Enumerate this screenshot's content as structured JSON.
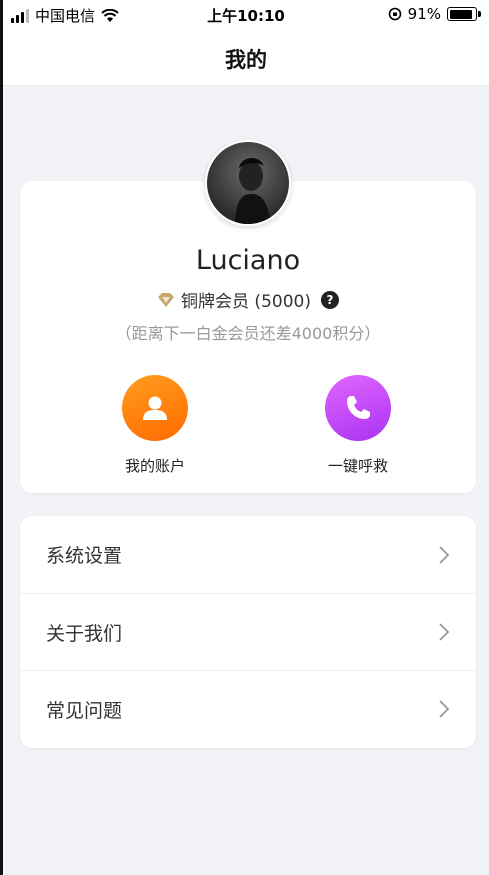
{
  "status_bar": {
    "carrier": "中国电信",
    "time": "上午10:10",
    "battery": "91%"
  },
  "header": {
    "title": "我的"
  },
  "profile": {
    "name": "Luciano",
    "member_level": "铜牌会员 (5000)",
    "help": "?",
    "points_note": "（距离下一白金会员还差4000积分）"
  },
  "actions": [
    {
      "label": "我的账户",
      "icon": "person-icon",
      "color": "#ff8a00"
    },
    {
      "label": "一键呼救",
      "icon": "phone-icon",
      "color": "#c04bf7"
    }
  ],
  "menu": {
    "items": [
      {
        "label": "系统设置"
      },
      {
        "label": "关于我们"
      },
      {
        "label": "常见问题"
      }
    ]
  }
}
